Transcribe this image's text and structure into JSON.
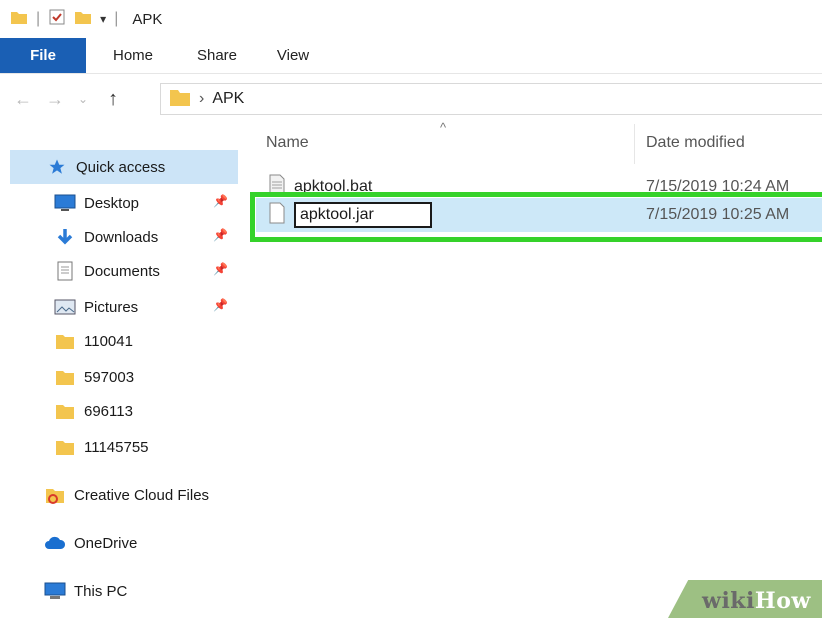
{
  "window": {
    "title": "APK"
  },
  "ribbon": {
    "tabs": [
      "File",
      "Home",
      "Share",
      "View"
    ]
  },
  "address": {
    "segments": [
      "APK"
    ]
  },
  "nav_pane": {
    "quick_access": "Quick access",
    "pinned": [
      {
        "label": "Desktop",
        "icon": "desktop-icon"
      },
      {
        "label": "Downloads",
        "icon": "download-icon"
      },
      {
        "label": "Documents",
        "icon": "documents-icon"
      },
      {
        "label": "Pictures",
        "icon": "pictures-icon"
      }
    ],
    "folders": [
      "110041",
      "597003",
      "696113",
      "11145755"
    ],
    "creative_cloud": "Creative Cloud Files",
    "onedrive": "OneDrive",
    "this_pc": "This PC"
  },
  "file_list": {
    "col_name": "Name",
    "col_date": "Date modified",
    "files": [
      {
        "name": "apktool.bat",
        "date": "7/15/2019 10:24 AM"
      },
      {
        "name": "apktool.jar",
        "date": "7/15/2019 10:25 AM",
        "renaming": true
      }
    ]
  },
  "watermark": {
    "part1": "wiki",
    "part2": "How"
  },
  "colors": {
    "file_tab": "#1a5fb4",
    "selection": "#cde8f8",
    "highlight": "#35d22a",
    "folder": "#f3c54e"
  }
}
